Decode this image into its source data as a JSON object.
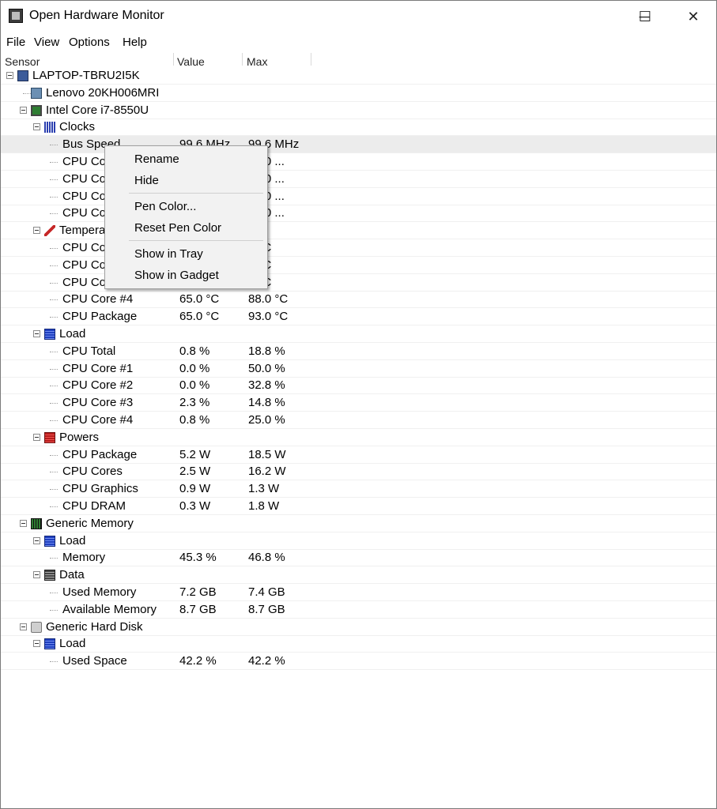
{
  "window": {
    "title": "Open Hardware Monitor",
    "controls": {
      "minimize": "─",
      "maximize": "☐",
      "close": "✕"
    }
  },
  "menu": [
    "File",
    "View",
    "Options",
    "Help"
  ],
  "columns": {
    "sensor": "Sensor",
    "value": "Value",
    "max": "Max"
  },
  "tree": [
    {
      "level": 0,
      "expander": true,
      "icon": "laptop-icon",
      "name": "LAPTOP-TBRU2I5K",
      "value": "",
      "max": ""
    },
    {
      "level": 1,
      "expander": false,
      "icon": "motherboard-icon",
      "name": "Lenovo 20KH006MRI",
      "value": "",
      "max": ""
    },
    {
      "level": 1,
      "expander": true,
      "icon": "cpu-icon",
      "name": "Intel Core i7-8550U",
      "value": "",
      "max": ""
    },
    {
      "level": 2,
      "expander": true,
      "icon": "clock-icon",
      "name": "Clocks",
      "value": "",
      "max": ""
    },
    {
      "level": 3,
      "name": "Bus Speed",
      "value": "99.6 MHz",
      "max": "99.6 MHz",
      "highlight": true
    },
    {
      "level": 3,
      "name": "CPU Co",
      "value": "",
      "max": "84.0 ..."
    },
    {
      "level": 3,
      "name": "CPU Co",
      "value": "",
      "max": "84.0 ..."
    },
    {
      "level": 3,
      "name": "CPU Co",
      "value": "",
      "max": "84.0 ..."
    },
    {
      "level": 3,
      "name": "CPU Co",
      "value": "",
      "max": "84.0 ..."
    },
    {
      "level": 2,
      "expander": true,
      "icon": "thermometer-icon",
      "name": "Tempera",
      "value": "",
      "max": ""
    },
    {
      "level": 3,
      "name": "CPU Co",
      "value": "",
      "max": "0 °C"
    },
    {
      "level": 3,
      "name": "CPU Co",
      "value": "",
      "max": "0 °C"
    },
    {
      "level": 3,
      "name": "CPU Co",
      "value": "",
      "max": "0 °C"
    },
    {
      "level": 3,
      "name": "CPU Core #4",
      "value": "65.0 °C",
      "max": "88.0 °C"
    },
    {
      "level": 3,
      "name": "CPU Package",
      "value": "65.0 °C",
      "max": "93.0 °C"
    },
    {
      "level": 2,
      "expander": true,
      "icon": "load-icon",
      "name": "Load",
      "value": "",
      "max": ""
    },
    {
      "level": 3,
      "name": "CPU Total",
      "value": "0.8 %",
      "max": "18.8 %"
    },
    {
      "level": 3,
      "name": "CPU Core #1",
      "value": "0.0 %",
      "max": "50.0 %"
    },
    {
      "level": 3,
      "name": "CPU Core #2",
      "value": "0.0 %",
      "max": "32.8 %"
    },
    {
      "level": 3,
      "name": "CPU Core #3",
      "value": "2.3 %",
      "max": "14.8 %"
    },
    {
      "level": 3,
      "name": "CPU Core #4",
      "value": "0.8 %",
      "max": "25.0 %"
    },
    {
      "level": 2,
      "expander": true,
      "icon": "power-icon",
      "name": "Powers",
      "value": "",
      "max": ""
    },
    {
      "level": 3,
      "name": "CPU Package",
      "value": "5.2 W",
      "max": "18.5 W"
    },
    {
      "level": 3,
      "name": "CPU Cores",
      "value": "2.5 W",
      "max": "16.2 W"
    },
    {
      "level": 3,
      "name": "CPU Graphics",
      "value": "0.9 W",
      "max": "1.3 W"
    },
    {
      "level": 3,
      "name": "CPU DRAM",
      "value": "0.3 W",
      "max": "1.8 W"
    },
    {
      "level": 1,
      "expander": true,
      "icon": "memory-icon",
      "name": "Generic Memory",
      "value": "",
      "max": ""
    },
    {
      "level": 2,
      "expander": true,
      "icon": "load-icon",
      "name": "Load",
      "value": "",
      "max": ""
    },
    {
      "level": 3,
      "name": "Memory",
      "value": "45.3 %",
      "max": "46.8 %"
    },
    {
      "level": 2,
      "expander": true,
      "icon": "data-icon",
      "name": "Data",
      "value": "",
      "max": ""
    },
    {
      "level": 3,
      "name": "Used Memory",
      "value": "7.2 GB",
      "max": "7.4 GB"
    },
    {
      "level": 3,
      "name": "Available Memory",
      "value": "8.7 GB",
      "max": "8.7 GB"
    },
    {
      "level": 1,
      "expander": true,
      "icon": "hard-disk-icon",
      "name": "Generic Hard Disk",
      "value": "",
      "max": ""
    },
    {
      "level": 2,
      "expander": true,
      "icon": "load-icon",
      "name": "Load",
      "value": "",
      "max": ""
    },
    {
      "level": 3,
      "name": "Used Space",
      "value": "42.2 %",
      "max": "42.2 %"
    }
  ],
  "context_menu": {
    "groups": [
      [
        "Rename",
        "Hide"
      ],
      [
        "Pen Color...",
        "Reset Pen Color"
      ],
      [
        "Show in Tray",
        "Show in Gadget"
      ]
    ]
  }
}
